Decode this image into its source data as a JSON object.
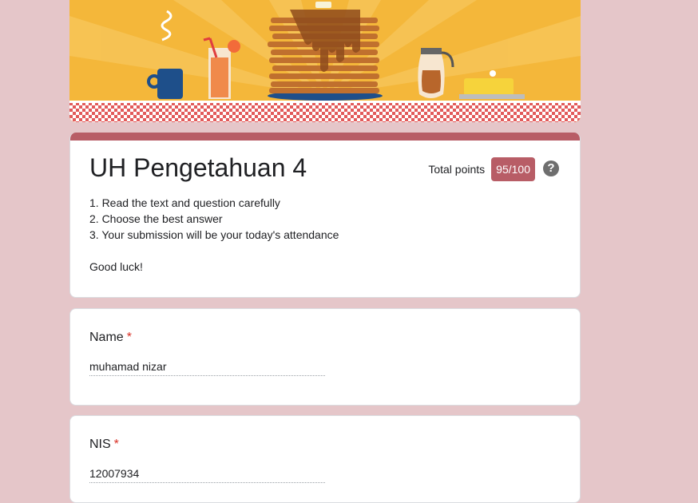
{
  "form": {
    "title": "UH Pengetahuan 4",
    "total_points_label": "Total points",
    "score": "95/100",
    "description": [
      "1. Read the text and question carefully",
      "2. Choose the best answer",
      "3. Your submission will be your today's attendance",
      "",
      "Good luck!"
    ],
    "accent_color": "#b85d66",
    "background_color": "#e5c6c9"
  },
  "questions": [
    {
      "label": "Name",
      "required_mark": "*",
      "answer": "muhamad nizar"
    },
    {
      "label": "NIS",
      "required_mark": "*",
      "answer": "12007934"
    }
  ],
  "icons": {
    "help": "help-icon",
    "banner": "breakfast-pancakes-illustration"
  }
}
